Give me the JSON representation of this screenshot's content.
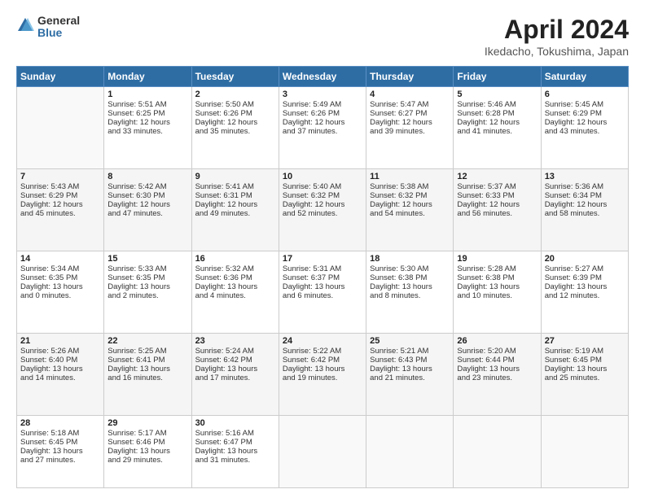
{
  "logo": {
    "general": "General",
    "blue": "Blue"
  },
  "title": "April 2024",
  "subtitle": "Ikedacho, Tokushima, Japan",
  "headers": [
    "Sunday",
    "Monday",
    "Tuesday",
    "Wednesday",
    "Thursday",
    "Friday",
    "Saturday"
  ],
  "weeks": [
    [
      {
        "day": "",
        "content": ""
      },
      {
        "day": "1",
        "content": "Sunrise: 5:51 AM\nSunset: 6:25 PM\nDaylight: 12 hours\nand 33 minutes."
      },
      {
        "day": "2",
        "content": "Sunrise: 5:50 AM\nSunset: 6:26 PM\nDaylight: 12 hours\nand 35 minutes."
      },
      {
        "day": "3",
        "content": "Sunrise: 5:49 AM\nSunset: 6:26 PM\nDaylight: 12 hours\nand 37 minutes."
      },
      {
        "day": "4",
        "content": "Sunrise: 5:47 AM\nSunset: 6:27 PM\nDaylight: 12 hours\nand 39 minutes."
      },
      {
        "day": "5",
        "content": "Sunrise: 5:46 AM\nSunset: 6:28 PM\nDaylight: 12 hours\nand 41 minutes."
      },
      {
        "day": "6",
        "content": "Sunrise: 5:45 AM\nSunset: 6:29 PM\nDaylight: 12 hours\nand 43 minutes."
      }
    ],
    [
      {
        "day": "7",
        "content": "Sunrise: 5:43 AM\nSunset: 6:29 PM\nDaylight: 12 hours\nand 45 minutes."
      },
      {
        "day": "8",
        "content": "Sunrise: 5:42 AM\nSunset: 6:30 PM\nDaylight: 12 hours\nand 47 minutes."
      },
      {
        "day": "9",
        "content": "Sunrise: 5:41 AM\nSunset: 6:31 PM\nDaylight: 12 hours\nand 49 minutes."
      },
      {
        "day": "10",
        "content": "Sunrise: 5:40 AM\nSunset: 6:32 PM\nDaylight: 12 hours\nand 52 minutes."
      },
      {
        "day": "11",
        "content": "Sunrise: 5:38 AM\nSunset: 6:32 PM\nDaylight: 12 hours\nand 54 minutes."
      },
      {
        "day": "12",
        "content": "Sunrise: 5:37 AM\nSunset: 6:33 PM\nDaylight: 12 hours\nand 56 minutes."
      },
      {
        "day": "13",
        "content": "Sunrise: 5:36 AM\nSunset: 6:34 PM\nDaylight: 12 hours\nand 58 minutes."
      }
    ],
    [
      {
        "day": "14",
        "content": "Sunrise: 5:34 AM\nSunset: 6:35 PM\nDaylight: 13 hours\nand 0 minutes."
      },
      {
        "day": "15",
        "content": "Sunrise: 5:33 AM\nSunset: 6:35 PM\nDaylight: 13 hours\nand 2 minutes."
      },
      {
        "day": "16",
        "content": "Sunrise: 5:32 AM\nSunset: 6:36 PM\nDaylight: 13 hours\nand 4 minutes."
      },
      {
        "day": "17",
        "content": "Sunrise: 5:31 AM\nSunset: 6:37 PM\nDaylight: 13 hours\nand 6 minutes."
      },
      {
        "day": "18",
        "content": "Sunrise: 5:30 AM\nSunset: 6:38 PM\nDaylight: 13 hours\nand 8 minutes."
      },
      {
        "day": "19",
        "content": "Sunrise: 5:28 AM\nSunset: 6:38 PM\nDaylight: 13 hours\nand 10 minutes."
      },
      {
        "day": "20",
        "content": "Sunrise: 5:27 AM\nSunset: 6:39 PM\nDaylight: 13 hours\nand 12 minutes."
      }
    ],
    [
      {
        "day": "21",
        "content": "Sunrise: 5:26 AM\nSunset: 6:40 PM\nDaylight: 13 hours\nand 14 minutes."
      },
      {
        "day": "22",
        "content": "Sunrise: 5:25 AM\nSunset: 6:41 PM\nDaylight: 13 hours\nand 16 minutes."
      },
      {
        "day": "23",
        "content": "Sunrise: 5:24 AM\nSunset: 6:42 PM\nDaylight: 13 hours\nand 17 minutes."
      },
      {
        "day": "24",
        "content": "Sunrise: 5:22 AM\nSunset: 6:42 PM\nDaylight: 13 hours\nand 19 minutes."
      },
      {
        "day": "25",
        "content": "Sunrise: 5:21 AM\nSunset: 6:43 PM\nDaylight: 13 hours\nand 21 minutes."
      },
      {
        "day": "26",
        "content": "Sunrise: 5:20 AM\nSunset: 6:44 PM\nDaylight: 13 hours\nand 23 minutes."
      },
      {
        "day": "27",
        "content": "Sunrise: 5:19 AM\nSunset: 6:45 PM\nDaylight: 13 hours\nand 25 minutes."
      }
    ],
    [
      {
        "day": "28",
        "content": "Sunrise: 5:18 AM\nSunset: 6:45 PM\nDaylight: 13 hours\nand 27 minutes."
      },
      {
        "day": "29",
        "content": "Sunrise: 5:17 AM\nSunset: 6:46 PM\nDaylight: 13 hours\nand 29 minutes."
      },
      {
        "day": "30",
        "content": "Sunrise: 5:16 AM\nSunset: 6:47 PM\nDaylight: 13 hours\nand 31 minutes."
      },
      {
        "day": "",
        "content": ""
      },
      {
        "day": "",
        "content": ""
      },
      {
        "day": "",
        "content": ""
      },
      {
        "day": "",
        "content": ""
      }
    ]
  ]
}
